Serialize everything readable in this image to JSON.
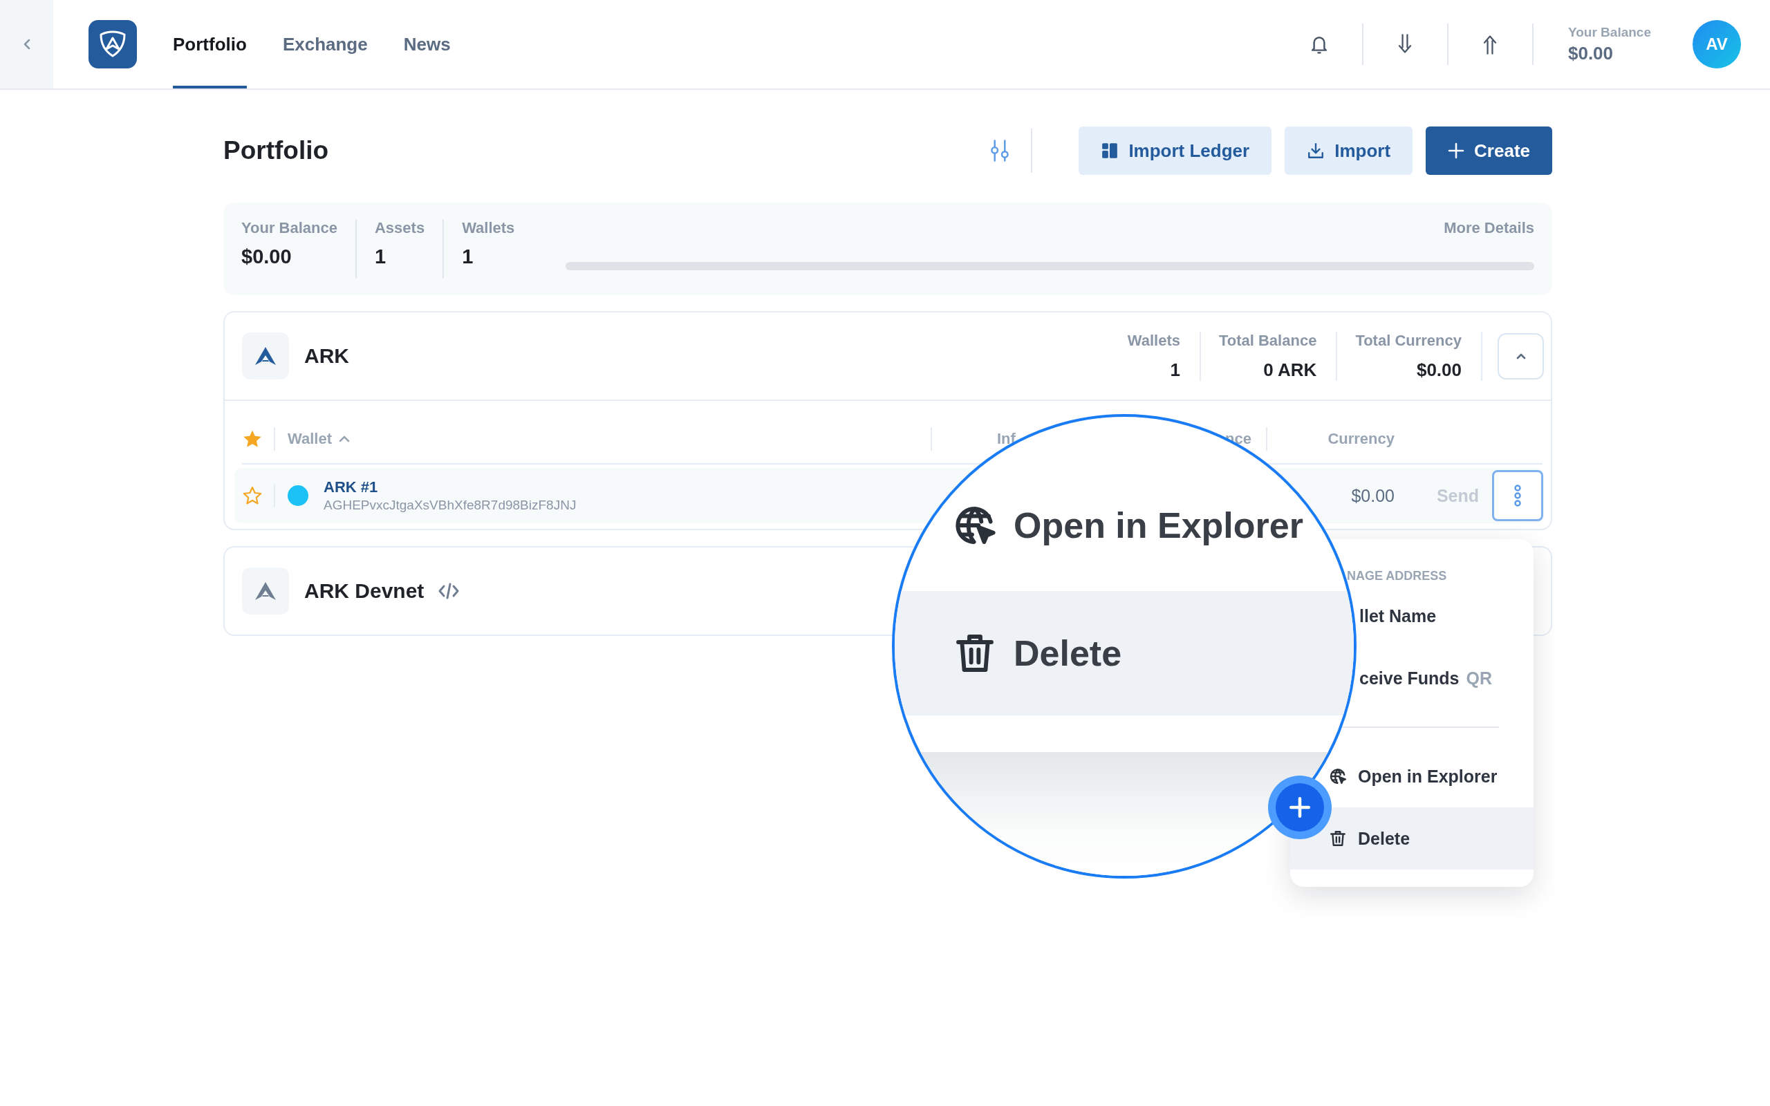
{
  "header": {
    "tabs": [
      {
        "label": "Portfolio",
        "selected": true
      },
      {
        "label": "Exchange",
        "selected": false
      },
      {
        "label": "News",
        "selected": false
      }
    ],
    "balance_label": "Your Balance",
    "balance": "$0.00",
    "avatar": "AV"
  },
  "page": {
    "title": "Portfolio",
    "buttons": [
      {
        "label": "Import Ledger",
        "kind": "ledger"
      },
      {
        "label": "Import",
        "kind": "import"
      },
      {
        "label": "Create",
        "kind": "create"
      }
    ]
  },
  "summary": {
    "stats": [
      {
        "label": "Your Balance",
        "value": "$0.00"
      },
      {
        "label": "Assets",
        "value": "1"
      },
      {
        "label": "Wallets",
        "value": "1"
      }
    ],
    "more": "More Details"
  },
  "networks": [
    {
      "name": "ARK",
      "expanded": true,
      "stats": [
        {
          "label": "Wallets",
          "value": "1"
        },
        {
          "label": "Total Balance",
          "value": "0 ARK"
        },
        {
          "label": "Total Currency",
          "value": "$0.00"
        }
      ],
      "table": {
        "columns": [
          "Wallet",
          "Inf",
          "nce",
          "Currency"
        ],
        "rows": [
          {
            "starred": false,
            "color": "#1cc1f6",
            "name": "ARK #1",
            "address": "AGHEPvxcJtgaXsVBhXfe8R7d98BizF8JNJ",
            "currency": "$0.00",
            "action": "Send"
          }
        ]
      }
    },
    {
      "name": "ARK Devnet",
      "expanded": false
    }
  ],
  "menu": {
    "section": "NAGE ADDRESS",
    "items": [
      {
        "label": "llet Name",
        "kind": "text",
        "selected": false
      },
      {
        "label": "ceive Funds",
        "suffix": "QR",
        "kind": "text",
        "selected": false
      },
      {
        "label": "Open in Explorer",
        "kind": "globe",
        "selected": false
      },
      {
        "label": "Delete",
        "kind": "trash",
        "selected": true
      }
    ]
  },
  "magnifier": {
    "items": [
      {
        "label": "Open in Explorer",
        "kind": "globe",
        "selected": false
      },
      {
        "label": "Delete",
        "kind": "trash",
        "selected": true
      }
    ]
  }
}
